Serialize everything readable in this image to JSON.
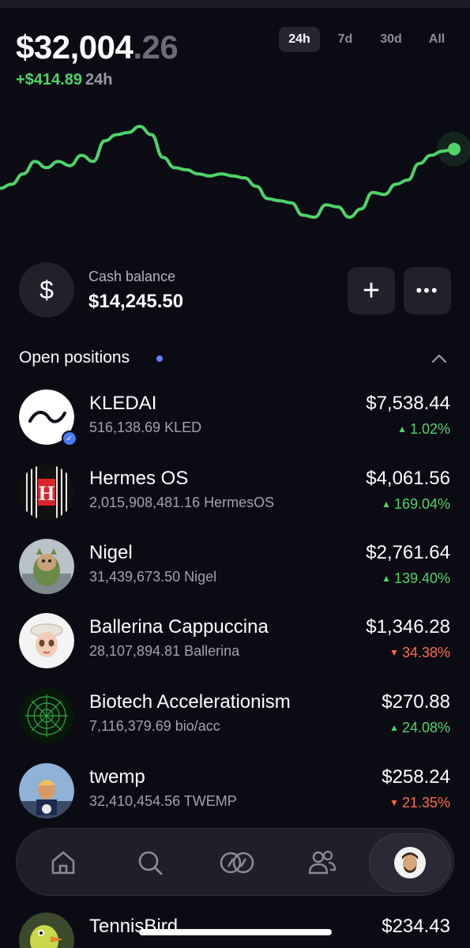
{
  "header": {
    "balance_main": "$32,004",
    "balance_cents": ".26",
    "change_amount": "+$414.89",
    "change_period": "24h",
    "ranges": [
      "24h",
      "7d",
      "30d",
      "All"
    ],
    "active_range": "24h"
  },
  "chart_data": {
    "type": "line",
    "title": "",
    "xlabel": "",
    "ylabel": "",
    "grid": false,
    "x": [
      0,
      1,
      2,
      3,
      4,
      5,
      6,
      7,
      8,
      9,
      10,
      11,
      12,
      13,
      14,
      15,
      16,
      17,
      18,
      19,
      20,
      21,
      22,
      23,
      24,
      25,
      26,
      27,
      28,
      29,
      30,
      31,
      32,
      33,
      34,
      35,
      36,
      37,
      38,
      39
    ],
    "values": [
      32.3,
      32.5,
      33.0,
      33.6,
      33.3,
      33.6,
      33.4,
      33.9,
      33.6,
      34.6,
      34.9,
      35.0,
      35.3,
      34.9,
      33.8,
      33.3,
      33.2,
      33.0,
      32.9,
      33.0,
      32.9,
      32.8,
      32.4,
      31.8,
      31.7,
      31.6,
      31.0,
      30.9,
      31.5,
      31.4,
      30.9,
      31.3,
      32.1,
      32.0,
      32.5,
      32.7,
      33.5,
      33.9,
      34.1,
      34.2
    ],
    "color": "#4fd36a"
  },
  "cash": {
    "icon": "dollar-icon",
    "label": "Cash balance",
    "value": "$14,245.50",
    "add_label": "+",
    "more_label": "•••"
  },
  "positions": {
    "title": "Open positions",
    "items": [
      {
        "name": "KLEDAI",
        "qty": "516,138.69 KLED",
        "value": "$7,538.44",
        "change": "1.02%",
        "dir": "up",
        "icon": "kledai-logo"
      },
      {
        "name": "Hermes OS",
        "qty": "2,015,908,481.16 HermesOS",
        "value": "$4,061.56",
        "change": "169.04%",
        "dir": "up",
        "icon": "hermes-logo"
      },
      {
        "name": "Nigel",
        "qty": "31,439,673.50 Nigel",
        "value": "$2,761.64",
        "change": "139.40%",
        "dir": "up",
        "icon": "nigel-avatar"
      },
      {
        "name": "Ballerina Cappuccina",
        "qty": "28,107,894.81 Ballerina",
        "value": "$1,346.28",
        "change": "34.38%",
        "dir": "down",
        "icon": "ballerina-avatar"
      },
      {
        "name": "Biotech Accelerationism",
        "qty": "7,116,379.69 bio/acc",
        "value": "$270.88",
        "change": "24.08%",
        "dir": "up",
        "icon": "bioacc-avatar"
      },
      {
        "name": "twemp",
        "qty": "32,410,454.56 TWEMP",
        "value": "$258.24",
        "change": "21.35%",
        "dir": "down",
        "icon": "twemp-avatar"
      },
      {
        "name": "TennisBird",
        "qty": "",
        "value": "$234.43",
        "change": "",
        "dir": "up",
        "icon": "tennisbird-avatar"
      }
    ]
  },
  "nav": {
    "items": [
      "home-icon",
      "search-icon",
      "swap-icon",
      "friends-icon",
      "profile-avatar"
    ]
  }
}
